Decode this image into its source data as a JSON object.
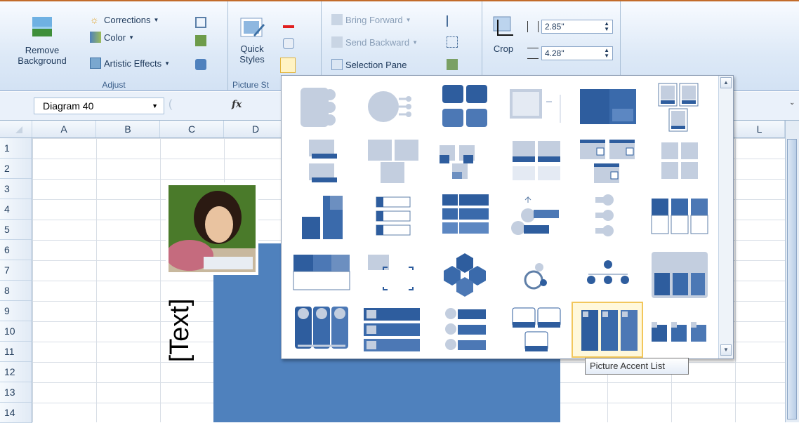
{
  "ribbon": {
    "remove_background": "Remove Background",
    "adjust_label": "Adjust",
    "corrections": "Corrections",
    "color": "Color",
    "artistic_effects": "Artistic Effects",
    "quick_styles": "Quick Styles",
    "picture_styles_label": "Picture St",
    "bring_forward": "Bring Forward",
    "send_backward": "Send Backward",
    "selection_pane": "Selection Pane",
    "crop": "Crop",
    "height_value": "2.85\"",
    "width_value": "4.28\""
  },
  "formula_bar": {
    "name_box": "Diagram 40",
    "fx": "fx"
  },
  "columns": [
    "A",
    "B",
    "C",
    "D",
    "L"
  ],
  "rows": [
    "1",
    "2",
    "3",
    "4",
    "5",
    "6",
    "7",
    "8",
    "9",
    "10",
    "11",
    "12",
    "13",
    "14"
  ],
  "sheet": {
    "placeholder_text": "[Text]",
    "accent_color": "#4f81bd"
  },
  "gallery": {
    "selected_layout": "Picture Accent List",
    "layout_count": 30
  },
  "tooltip": "Picture Accent List",
  "colors": {
    "ribbon_top": "#f8fbff",
    "ribbon_bottom": "#d3e2f4",
    "smartart_blue": "#4f81bd",
    "selection_gold": "#f2c75c"
  }
}
